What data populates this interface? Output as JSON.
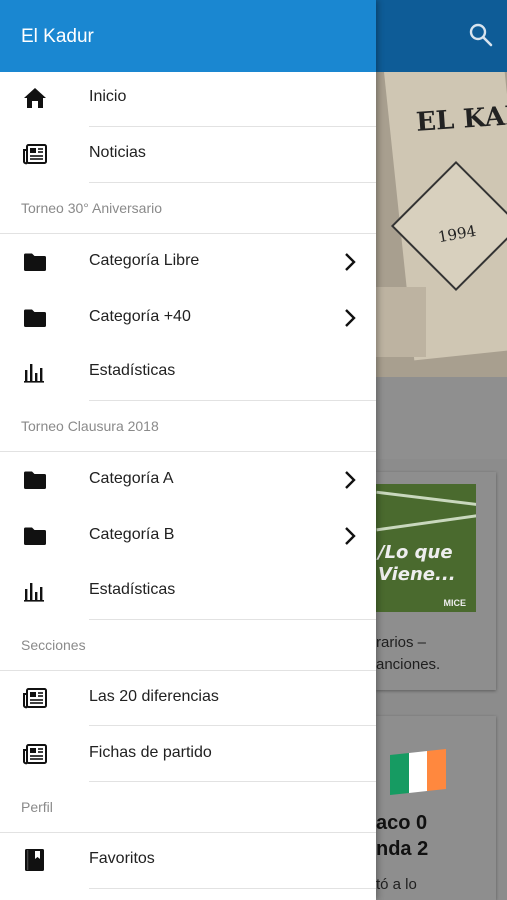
{
  "background": {
    "hero": {
      "title": "EL KAD",
      "year": "1994"
    },
    "card1": {
      "thumb_text": "/Lo que\nViene...",
      "thumb_brand": "MICE",
      "text": "rarios –\nanciones."
    },
    "card2": {
      "flag_colors": [
        "#169b62",
        "#ffffff",
        "#ff883e"
      ],
      "headline": "aco 0\nnda 2",
      "sub": "tó a lo"
    }
  },
  "colors": {
    "drawer_header": "#1a87d1",
    "app_bar": "#0e5c97"
  },
  "drawer": {
    "title": "El Kadur",
    "items": [
      {
        "label": "Inicio",
        "icon": "home-icon"
      },
      {
        "label": "Noticias",
        "icon": "newspaper-icon"
      },
      {
        "section": "Torneo 30° Aniversario"
      },
      {
        "label": "Categoría Libre",
        "icon": "folder-icon",
        "chevron": true
      },
      {
        "label": "Categoría +40",
        "icon": "folder-icon",
        "chevron": true
      },
      {
        "label": "Estadísticas",
        "icon": "bar-chart-icon"
      },
      {
        "section": "Torneo Clausura 2018"
      },
      {
        "label": "Categoría A",
        "icon": "folder-icon",
        "chevron": true
      },
      {
        "label": "Categoría B",
        "icon": "folder-icon",
        "chevron": true
      },
      {
        "label": "Estadísticas",
        "icon": "bar-chart-icon"
      },
      {
        "section": "Secciones"
      },
      {
        "label": "Las 20 diferencias",
        "icon": "newspaper-icon"
      },
      {
        "label": "Fichas de partido",
        "icon": "newspaper-icon"
      },
      {
        "section": "Perfil"
      },
      {
        "label": "Favoritos",
        "icon": "bookmark-book-icon"
      }
    ]
  }
}
